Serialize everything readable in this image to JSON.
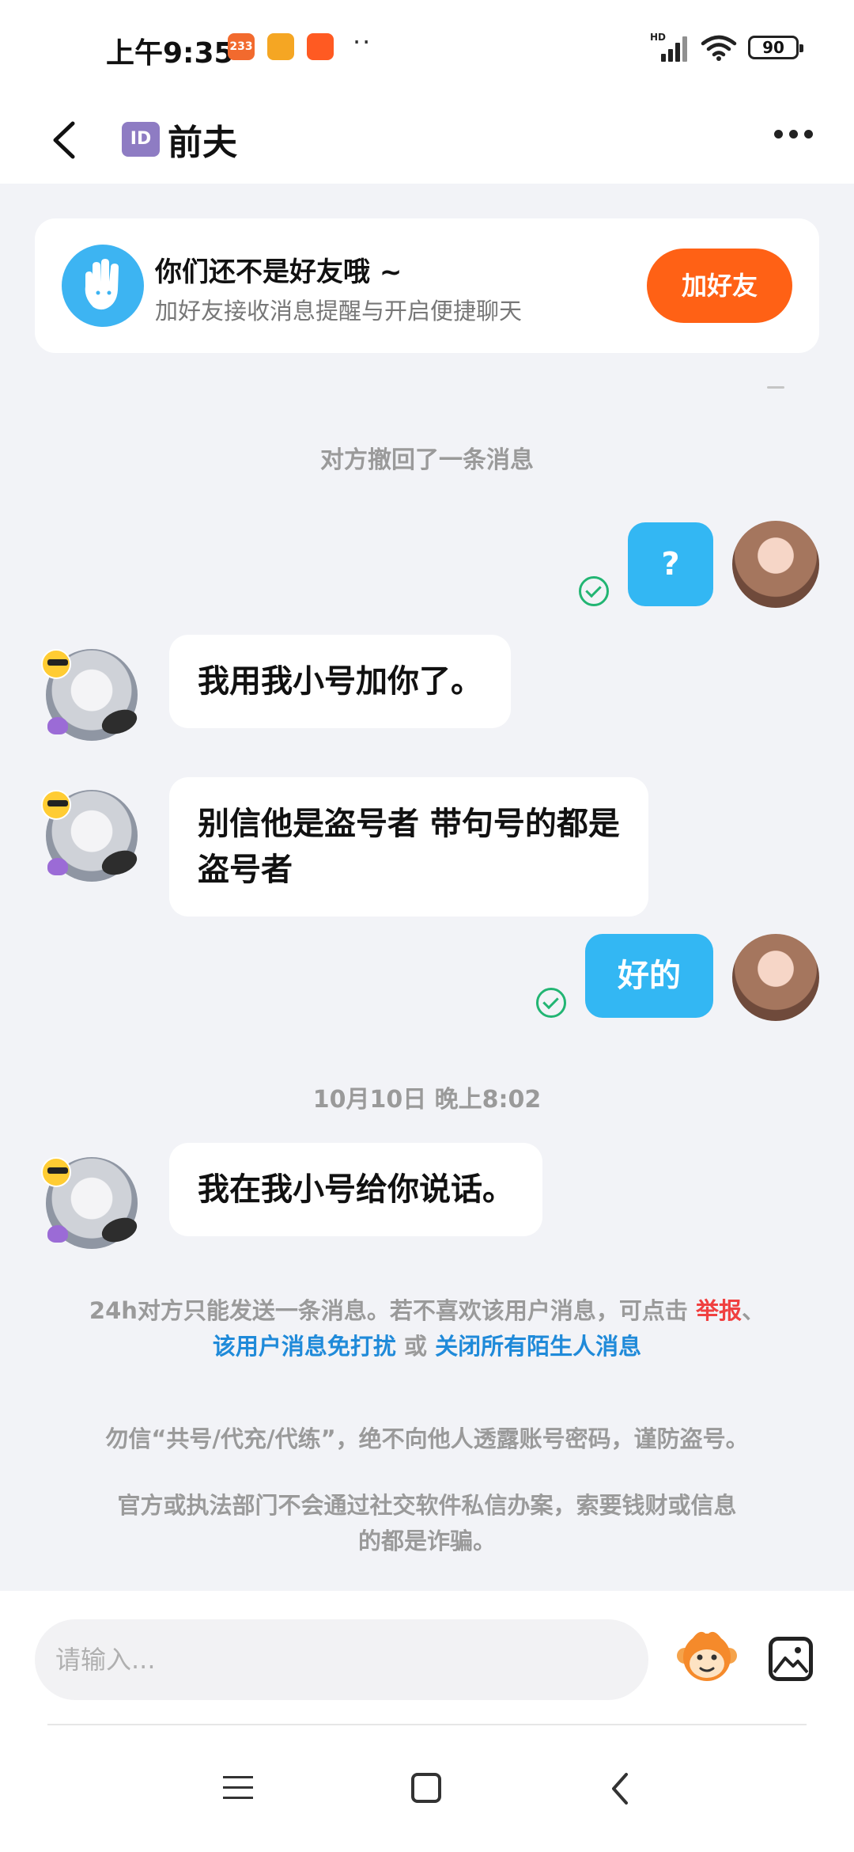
{
  "status_bar": {
    "time": "上午9:35",
    "app_badge_1": "233",
    "dots": "··",
    "hd_label": "HD",
    "battery": "90"
  },
  "header": {
    "id_badge": "ID",
    "title": "前夫"
  },
  "friend_banner": {
    "title": "你们还不是好友哦 ~",
    "subtitle": "加好友接收消息提醒与开启便捷聊天",
    "button": "加好友"
  },
  "messages": {
    "recalled": "对方撤回了一条消息",
    "mine_1": "?",
    "other_1": "我用我小号加你了。",
    "other_2_line1": "别信他是盗号者 带句号的都是",
    "other_2_line2": "盗号者",
    "mine_2": "好的",
    "timestamp": "10月10日 晚上8:02",
    "other_3": "我在我小号给你说话。"
  },
  "notices": {
    "limit_text": "24h对方只能发送一条消息。若不喜欢该用户消息，可点击",
    "report_link": "举报",
    "separator": "、",
    "mute_link": "该用户消息免打扰",
    "or_text": "或",
    "close_link": "关闭所有陌生人消息",
    "warning_1": "勿信“共号/代充/代练”，绝不向他人透露账号密码，谨防盗号。",
    "warning_2_line1": "官方或执法部门不会通过社交软件私信办案，索要钱财或信息",
    "warning_2_line2": "的都是诈骗。"
  },
  "input": {
    "placeholder": "请输入..."
  },
  "colors": {
    "accent_orange": "#ff6115",
    "bubble_blue": "#33b7f3",
    "link_blue": "#1f8ad9",
    "link_red": "#f04040",
    "read_green": "#22b573"
  }
}
